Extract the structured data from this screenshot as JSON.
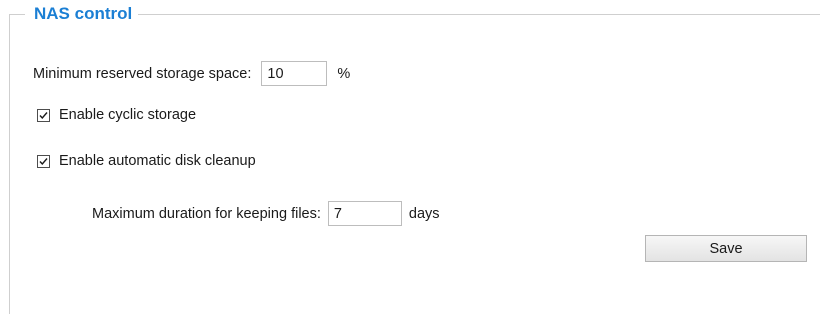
{
  "section": {
    "title": "NAS control"
  },
  "min_reserved": {
    "label": "Minimum reserved storage space:",
    "value": "10",
    "unit": "%"
  },
  "cyclic_storage": {
    "label": "Enable cyclic storage",
    "checked": true
  },
  "auto_cleanup": {
    "label": "Enable automatic disk cleanup",
    "checked": true
  },
  "max_duration": {
    "label": "Maximum duration for keeping files:",
    "value": "7",
    "unit": "days"
  },
  "actions": {
    "save_label": "Save"
  },
  "colors": {
    "accent": "#1b7fd4",
    "frame_border": "#cfcfcf"
  }
}
